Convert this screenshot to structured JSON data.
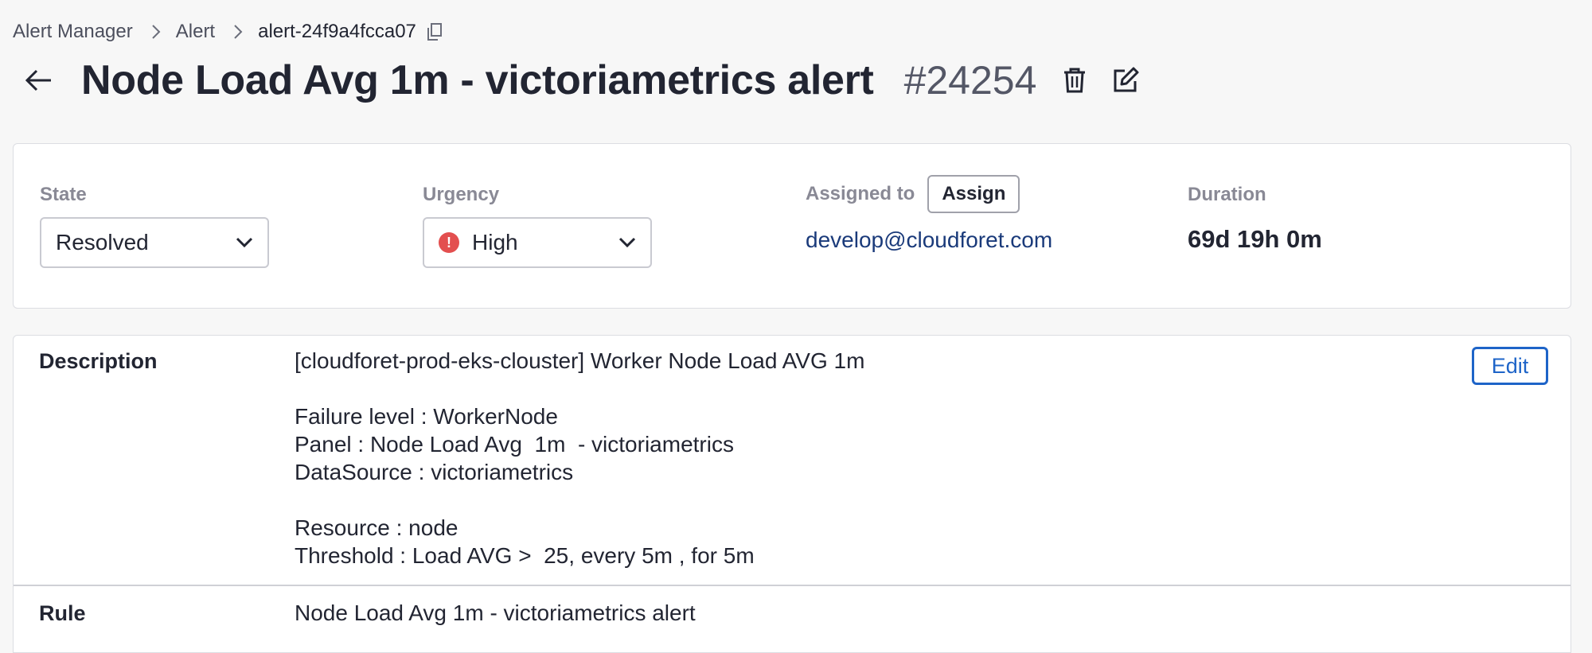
{
  "breadcrumb": {
    "items": [
      "Alert Manager",
      "Alert"
    ],
    "current": "alert-24f9a4fcca07"
  },
  "header": {
    "title": "Node Load Avg 1m - victoriametrics alert",
    "number": "#24254"
  },
  "info": {
    "state": {
      "label": "State",
      "value": "Resolved"
    },
    "urgency": {
      "label": "Urgency",
      "value": "High"
    },
    "assigned": {
      "label": "Assigned to",
      "button": "Assign",
      "assignee": "develop@cloudforet.com"
    },
    "duration": {
      "label": "Duration",
      "value": "69d 19h 0m"
    }
  },
  "details": {
    "description_label": "Description",
    "description_text": "[cloudforet-prod-eks-clouster] Worker Node Load AVG 1m\n\nFailure level : WorkerNode\nPanel : Node Load Avg  1m  - victoriametrics\nDataSource : victoriametrics\n\nResource : node\nThreshold : Load AVG >  25, every 5m , for 5m",
    "edit_label": "Edit",
    "rule_label": "Rule",
    "rule_value": "Node Load Avg 1m - victoriametrics alert"
  },
  "colors": {
    "accent": "#1e64c8",
    "urgency_high": "#e34f4f",
    "assignee_link": "#1a3a7a"
  },
  "icons": [
    "chevron-right-icon",
    "copy-icon",
    "arrow-left-icon",
    "trash-icon",
    "edit-icon",
    "chevron-down-icon",
    "alert-circle-icon"
  ]
}
